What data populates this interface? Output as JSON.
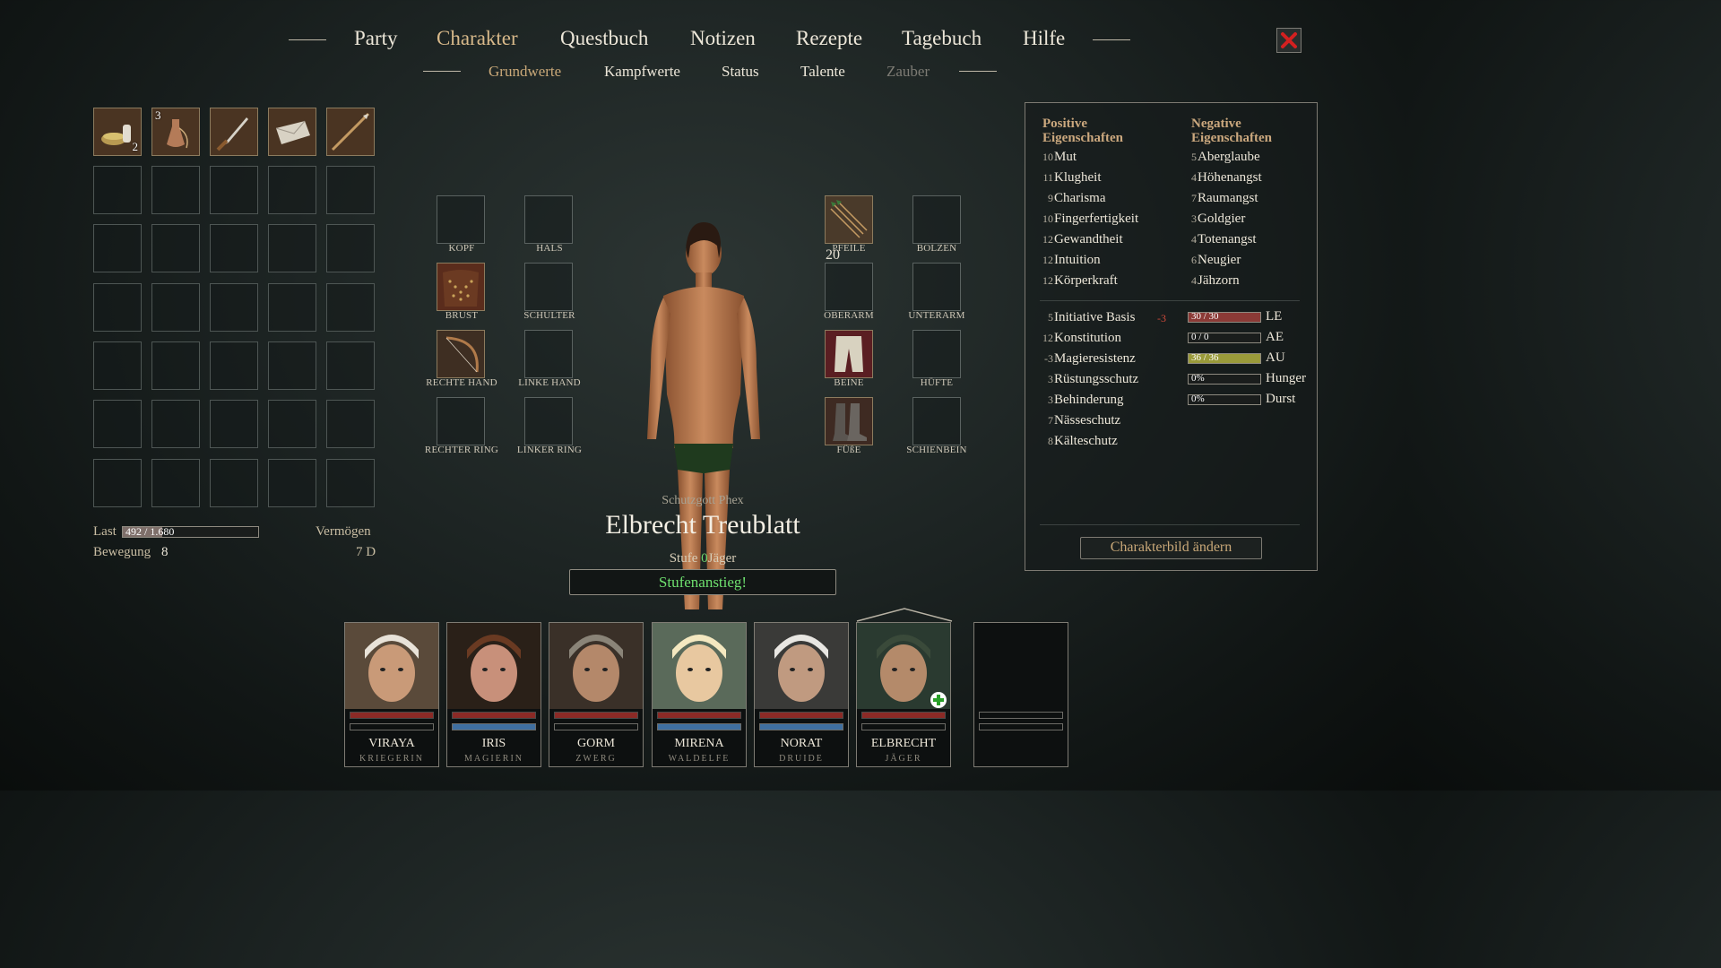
{
  "main_nav": {
    "items": [
      "Party",
      "Charakter",
      "Questbuch",
      "Notizen",
      "Rezepte",
      "Tagebuch",
      "Hilfe"
    ],
    "active": "Charakter"
  },
  "sub_nav": {
    "items": [
      "Grundwerte",
      "Kampfwerte",
      "Status",
      "Talente",
      "Zauber"
    ],
    "active": "Grundwerte",
    "disabled": "Zauber"
  },
  "inventory": {
    "filled_slots": [
      {
        "icon": "food-bowl-icon",
        "qty": "2"
      },
      {
        "icon": "flask-icon",
        "qty_top": "3"
      },
      {
        "icon": "dagger-icon"
      },
      {
        "icon": "letter-icon"
      },
      {
        "icon": "spear-icon"
      }
    ],
    "last_label": "Last",
    "last_value": "492 / 1.680",
    "last_fraction": 0.29,
    "vermoegen_label": "Vermögen",
    "vermoegen_value": "7 D",
    "bewegung_label": "Bewegung",
    "bewegung_value": "8"
  },
  "equipment": {
    "left": [
      {
        "label": "KOPF"
      },
      {
        "label": "HALS"
      },
      {
        "label": "BRUST"
      },
      {
        "label": "SCHULTER"
      },
      {
        "label": "RECHTE HAND"
      },
      {
        "label": "LINKE HAND"
      },
      {
        "label": "RECHTER RING"
      },
      {
        "label": "LINKER RING"
      }
    ],
    "right": [
      {
        "label": "PFEILE",
        "qty": "20"
      },
      {
        "label": "BOLZEN"
      },
      {
        "label": "OBERARM"
      },
      {
        "label": "UNTERARM"
      },
      {
        "label": "BEINE"
      },
      {
        "label": "HÜFTE"
      },
      {
        "label": "FÜßE"
      },
      {
        "label": "SCHIENBEIN"
      }
    ]
  },
  "character": {
    "patron": "Schutzgott Phex",
    "name": "Elbrecht Treublatt",
    "level_label": "Stufe",
    "level": "0",
    "class": "Jäger",
    "level_up_label": "Stufenanstieg!"
  },
  "stats": {
    "positive_header": "Positive Eigenschaften",
    "negative_header": "Negative Eigenschaften",
    "positive": [
      {
        "value": "10",
        "name": "Mut"
      },
      {
        "value": "11",
        "name": "Klugheit"
      },
      {
        "value": "9",
        "name": "Charisma"
      },
      {
        "value": "10",
        "name": "Fingerfertigkeit"
      },
      {
        "value": "12",
        "name": "Gewandtheit"
      },
      {
        "value": "12",
        "name": "Intuition"
      },
      {
        "value": "12",
        "name": "Körperkraft"
      }
    ],
    "negative": [
      {
        "value": "5",
        "name": "Aberglaube"
      },
      {
        "value": "4",
        "name": "Höhenangst"
      },
      {
        "value": "7",
        "name": "Raumangst"
      },
      {
        "value": "3",
        "name": "Goldgier"
      },
      {
        "value": "4",
        "name": "Totenangst"
      },
      {
        "value": "6",
        "name": "Neugier"
      },
      {
        "value": "4",
        "name": "Jähzorn"
      }
    ],
    "derived": [
      {
        "value": "5",
        "name": "Initiative Basis",
        "mod": "-3"
      },
      {
        "value": "12",
        "name": "Konstitution"
      },
      {
        "value": "-3",
        "name": "Magieresistenz"
      },
      {
        "value": "3",
        "name": "Rüstungsschutz"
      },
      {
        "value": "3",
        "name": "Behinderung"
      },
      {
        "value": "7",
        "name": "Nässeschutz"
      },
      {
        "value": "8",
        "name": "Kälteschutz"
      }
    ],
    "bars": [
      {
        "text": "30 / 30",
        "label": "LE",
        "fraction": 1.0,
        "color": "#8b3a36"
      },
      {
        "text": "0 / 0",
        "label": "AE",
        "fraction": 0.0,
        "color": "#3f6fa0"
      },
      {
        "text": "36 / 36",
        "label": "AU",
        "fraction": 1.0,
        "color": "#9a9a3a"
      },
      {
        "text": "0%",
        "label": "Hunger",
        "fraction": 0.0,
        "color": "#777"
      },
      {
        "text": "0%",
        "label": "Durst",
        "fraction": 0.0,
        "color": "#777"
      }
    ],
    "change_portrait_label": "Charakterbild ändern"
  },
  "party": [
    {
      "name": "VIRAYA",
      "class": "KRIEGERIN",
      "hp": 1.0,
      "mp": 0.0
    },
    {
      "name": "IRIS",
      "class": "MAGIERIN",
      "hp": 1.0,
      "mp": 1.0
    },
    {
      "name": "GORM",
      "class": "ZWERG",
      "hp": 1.0,
      "mp": 0.0
    },
    {
      "name": "MIRENA",
      "class": "WALDELFE",
      "hp": 1.0,
      "mp": 1.0
    },
    {
      "name": "NORAT",
      "class": "DRUIDE",
      "hp": 1.0,
      "mp": 1.0
    },
    {
      "name": "ELBRECHT",
      "class": "JÄGER",
      "hp": 1.0,
      "mp": 0.0,
      "active": true,
      "level_up": true
    }
  ],
  "colors": {
    "accent_gold": "#cba87e",
    "level_green": "#6ee06e",
    "close_red": "#d42020"
  }
}
